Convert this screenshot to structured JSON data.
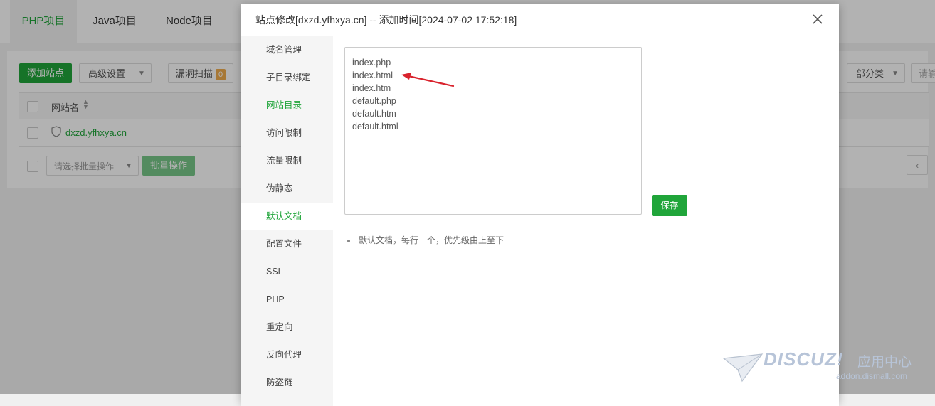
{
  "background": {
    "tabs": [
      "PHP项目",
      "Java项目",
      "Node项目"
    ],
    "toolbar": {
      "add_site": "添加站点",
      "advanced": "高级设置",
      "vuln_scan": "漏洞扫描",
      "vuln_count": "0",
      "category_partial": "部分类",
      "search_partial": "请输"
    },
    "table": {
      "col_site_name": "网站名",
      "row_site": "dxzd.yfhxya.cn"
    },
    "batch": {
      "select_placeholder": "请选择批量操作",
      "button": "批量操作"
    }
  },
  "modal": {
    "title": "站点修改[dxzd.yfhxya.cn] -- 添加时间[2024-07-02 17:52:18]",
    "menu": [
      "域名管理",
      "子目录绑定",
      "网站目录",
      "访问限制",
      "流量限制",
      "伪静态",
      "默认文档",
      "配置文件",
      "SSL",
      "PHP",
      "重定向",
      "反向代理",
      "防盗链"
    ],
    "selected_index": 6,
    "highlight_index": 2,
    "default_docs": "index.php\nindex.html\nindex.htm\ndefault.php\ndefault.htm\ndefault.html",
    "save_label": "保存",
    "tip": "默认文档，每行一个，优先级由上至下"
  },
  "watermark": {
    "brand": "DISCUZ!",
    "cn": "应用中心",
    "url": "addon.dismall.com"
  },
  "colors": {
    "accent": "#20a53a",
    "arrow": "#d9232d"
  }
}
